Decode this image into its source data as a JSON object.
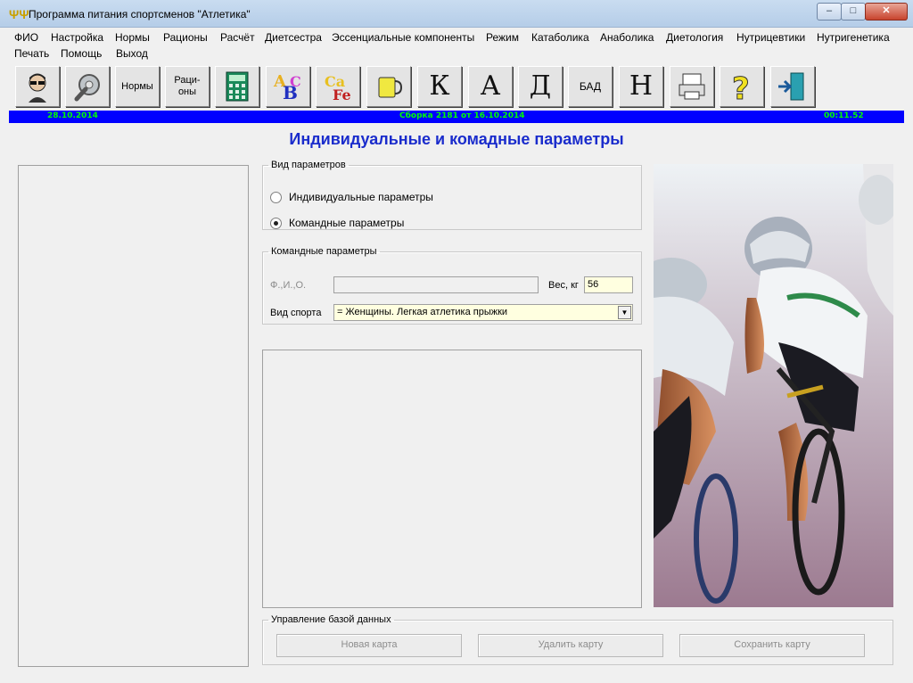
{
  "window": {
    "title": "Программа питания спортсменов \"Атлетика\"",
    "controls": {
      "minimize": "–",
      "maximize": "□",
      "close": "✕"
    }
  },
  "menu": {
    "row1": [
      "ФИО",
      "Настройка",
      "Нормы",
      "Рационы",
      "Расчёт",
      "Диетсестра",
      "Эссенциальные компоненты",
      "Режим",
      "Катаболика",
      "Анаболика",
      "Диетология",
      "Нутрицевтики",
      "Нутригенетика"
    ],
    "row2": [
      "Печать",
      "Помощь",
      "Выход"
    ]
  },
  "toolbar": {
    "norms": "Нормы",
    "rations_line1": "Раци-",
    "rations_line2": "оны",
    "k": "К",
    "a": "А",
    "d": "Д",
    "bad": "БАД",
    "n": "Н",
    "vitamin_letters": "A B C",
    "mineral_letters": "Ca Fe"
  },
  "status": {
    "date": "28.10.2014",
    "build": "Сборка 2181 от 16.10.2014",
    "time": "00:11.52"
  },
  "page_title": "Индивидуальные и комадные параметры",
  "param_type": {
    "legend": "Вид параметров",
    "individual": "Индивидуальные параметры",
    "team": "Командные параметры",
    "selected": "team"
  },
  "team_params": {
    "legend": "Командные параметры",
    "fio_label": "Ф.,И.,О.",
    "fio_value": "",
    "weight_label": "Вес, кг",
    "weight_value": "56",
    "sport_label": "Вид спорта",
    "sport_value": "= Женщины. Легкая атлетика прыжки"
  },
  "db": {
    "legend": "Управление базой данных",
    "new_card": "Новая карта",
    "delete_card": "Удалить карту",
    "save_card": "Сохранить карту"
  },
  "colors": {
    "status_bg": "#0000ff",
    "status_text": "#00ff00",
    "title_text": "#1a2ccc",
    "input_bg": "#ffffe0"
  }
}
